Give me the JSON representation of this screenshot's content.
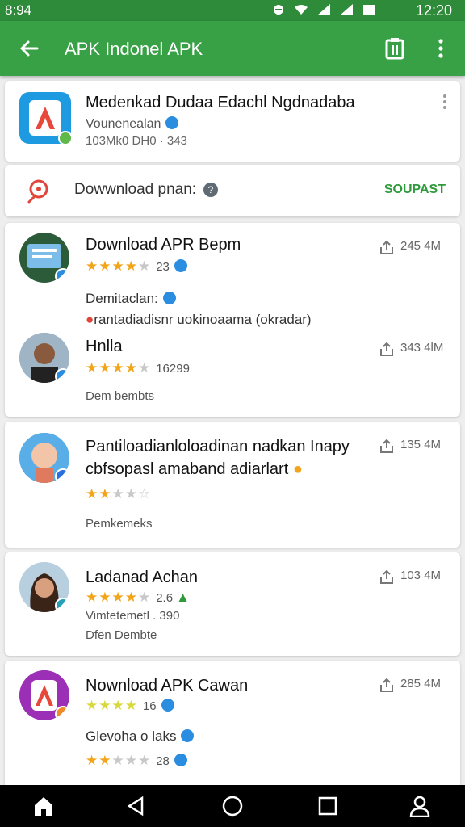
{
  "status": {
    "left": "8:94",
    "clock": "12:20"
  },
  "appbar": {
    "title": "APK Indonel APK"
  },
  "app_card": {
    "title": "Medenkad Dudaa Edachl Ngdnadaba",
    "subtitle": "Vounenealan",
    "meta": "103Mk0 DH0 · 343"
  },
  "download_row": {
    "label": "Dowwnload pnan:",
    "action": "SOUPAST"
  },
  "items": [
    {
      "title": "Download APR Bepm",
      "rating_num": "23",
      "size": "245 4M",
      "line1": "Demitaclan:",
      "line2": "rantadiadisnr uokinoaama (okradar)",
      "stars": 4
    },
    {
      "title": "Hnlla",
      "rating_num": "16299",
      "size": "343 4lM",
      "sub": "Dem bembts",
      "stars": 4
    },
    {
      "title": "Pantiloadianloloadinan nadkan Inapy",
      "line2": "cbfsopasl amaband adiarlart",
      "size": "135 4M",
      "sub": "Pemkemeks",
      "stars": 2
    },
    {
      "title": "Ladanad Achan",
      "rating_num": "2.6",
      "size": "103 4M",
      "line2": "Vimtetemetl . 390",
      "sub": "Dfen Dembte",
      "stars": 4
    },
    {
      "title": "Nownload APK Cawan",
      "rating_num": "16",
      "size": "285 4M",
      "line2": "Glevoha o laks",
      "rating_num2": "28",
      "stars": 4,
      "stars2": 2
    }
  ],
  "colors": {
    "primary": "#38a045",
    "status": "#2e8b3a",
    "accent": "#2e9a3c"
  }
}
